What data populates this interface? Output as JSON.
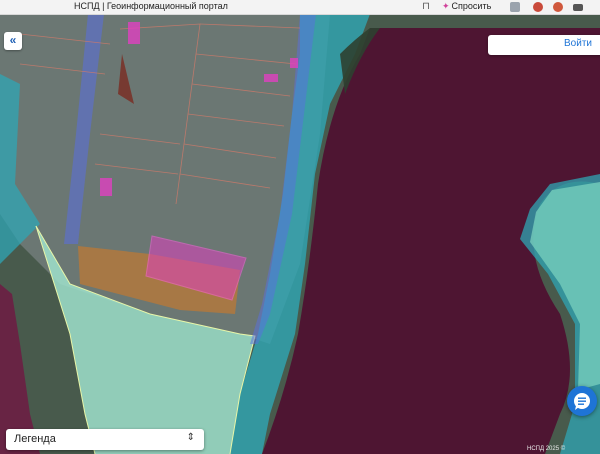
{
  "browser": {
    "tab_title": "НСПД | Геоинформационный портал",
    "ask_label": "Спросить",
    "bookmark_icon": "bookmark-icon"
  },
  "map": {
    "collapse_label": "«",
    "login_label": "Войти",
    "legend_label": "Легенда",
    "legend_chevron": "⌃⌄",
    "attribution": "НСПД 2025 ©",
    "colors": {
      "river": "#4e1532",
      "water_zone": "#2fa6b4",
      "floodplain": "#7fd6c0",
      "parcel_orange": "#c77a2c",
      "parcel_magenta": "#e040c0",
      "road_zone": "#5a6fe0",
      "accent": "#1e74d6"
    }
  }
}
